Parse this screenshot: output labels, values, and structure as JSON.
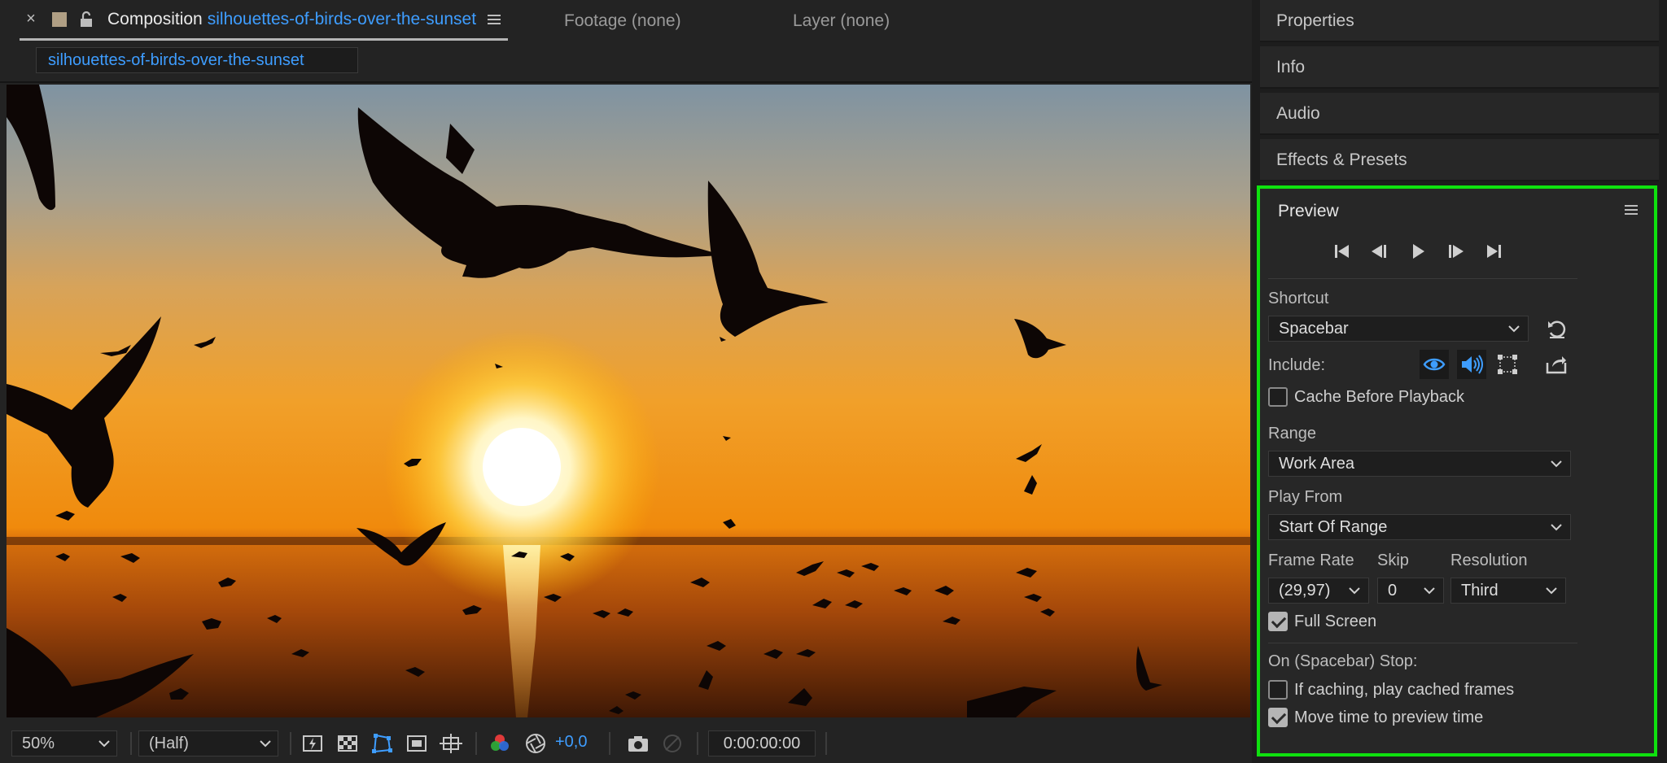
{
  "composition_tab": {
    "close": "×",
    "label": "Composition",
    "name": "silhouettes-of-birds-over-the-sunset"
  },
  "footage_tab": {
    "label": "Footage",
    "value": "(none)"
  },
  "layer_tab": {
    "label": "Layer",
    "value": "(none)"
  },
  "breadcrumb": "silhouettes-of-birds-over-the-sunset",
  "viewer_toolbar": {
    "zoom": "50%",
    "resolution": "(Half)",
    "exposure": "+0,0",
    "timecode": "0:00:00:00"
  },
  "side_panels": [
    "Properties",
    "Info",
    "Audio",
    "Effects & Presets"
  ],
  "preview": {
    "title": "Preview",
    "shortcut_label": "Shortcut",
    "shortcut_value": "Spacebar",
    "include_label": "Include:",
    "cache_before_playback": {
      "label": "Cache Before Playback",
      "checked": false
    },
    "range_label": "Range",
    "range_value": "Work Area",
    "play_from_label": "Play From",
    "play_from_value": "Start Of Range",
    "frame_rate_label": "Frame Rate",
    "frame_rate_value": "(29,97)",
    "skip_label": "Skip",
    "skip_value": "0",
    "resolution_label": "Resolution",
    "resolution_value": "Third",
    "full_screen": {
      "label": "Full Screen",
      "checked": true
    },
    "on_stop_label": "On (Spacebar) Stop:",
    "if_caching": {
      "label": "If caching, play cached frames",
      "checked": false
    },
    "move_time": {
      "label": "Move time to preview time",
      "checked": true
    }
  },
  "colors": {
    "accent_blue": "#3e9dff",
    "highlight_border": "#0fe10f",
    "panel_bg": "#272727"
  }
}
